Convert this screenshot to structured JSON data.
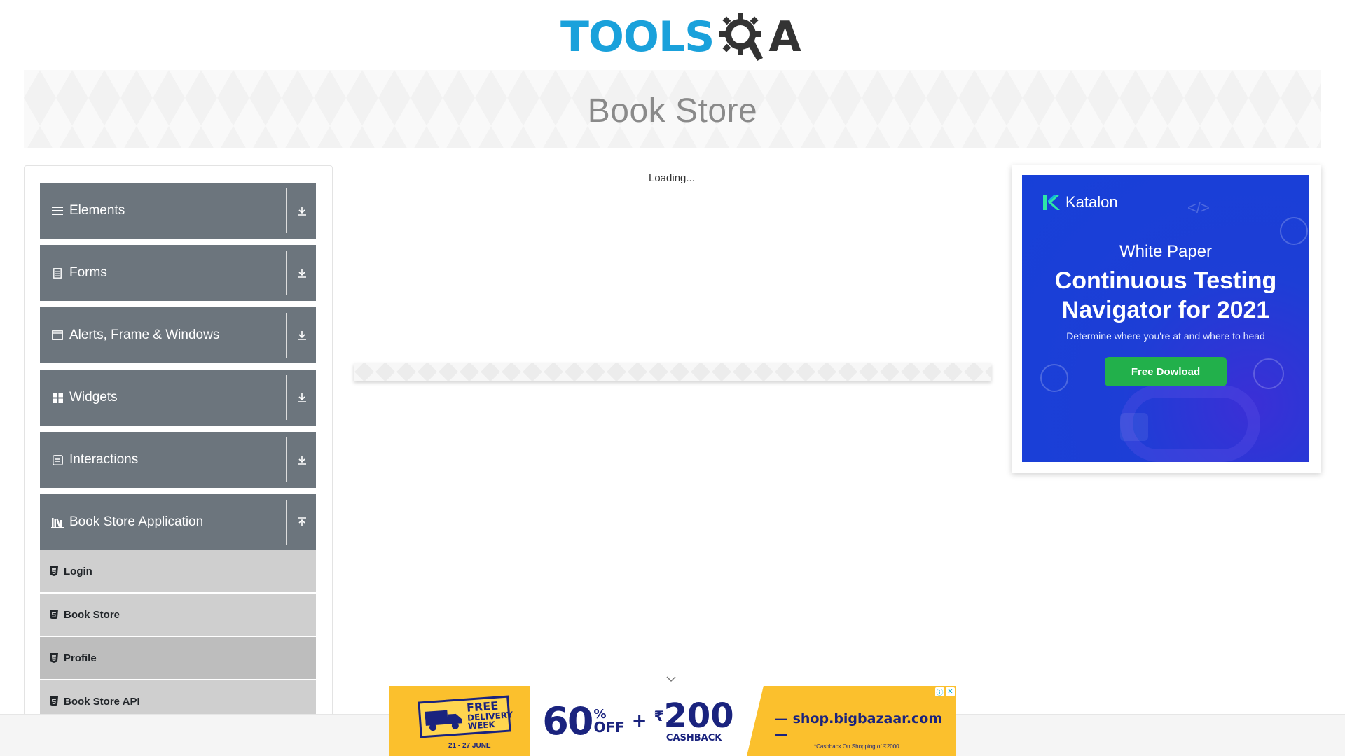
{
  "logo": {
    "text": "TOOLS",
    "suffix": "A",
    "brand_color": "#1aa1db"
  },
  "banner": {
    "title": "Book Store"
  },
  "menu": {
    "groups": [
      {
        "label": "Elements",
        "icon": "bars-icon",
        "state": "collapsed"
      },
      {
        "label": "Forms",
        "icon": "form-icon",
        "state": "collapsed"
      },
      {
        "label": "Alerts, Frame & Windows",
        "icon": "window-icon",
        "state": "collapsed"
      },
      {
        "label": "Widgets",
        "icon": "widgets-icon",
        "state": "collapsed"
      },
      {
        "label": "Interactions",
        "icon": "interactions-icon",
        "state": "collapsed"
      },
      {
        "label": "Book Store Application",
        "icon": "books-icon",
        "state": "expanded"
      }
    ],
    "book_store_items": [
      {
        "label": "Login"
      },
      {
        "label": "Book Store"
      },
      {
        "label": "Profile",
        "active": true
      },
      {
        "label": "Book Store API"
      }
    ],
    "header_color": "#6c757d"
  },
  "main": {
    "loading_text": "Loading..."
  },
  "right_ad": {
    "brand": "Katalon",
    "subtitle": "White Paper",
    "title_line1": "Continuous Testing",
    "title_line2": "Navigator for 2021",
    "description": "Determine where you're at and where to head",
    "button_label": "Free Dowload",
    "button_color": "#22b04b"
  },
  "bottom_ad": {
    "free_line1": "FREE",
    "free_line2": "DELIVERY",
    "free_line3": "WEEK",
    "dates": "21 - 27 JUNE",
    "discount": "60",
    "pct": "%",
    "off": "OFF",
    "plus": "+",
    "rupee": "₹",
    "cashback_amount": "200",
    "cashback_label": "CASHBACK",
    "url": "— shop.bigbazaar.com —",
    "fine_print": "*Cashback On Shopping of ₹2000"
  }
}
